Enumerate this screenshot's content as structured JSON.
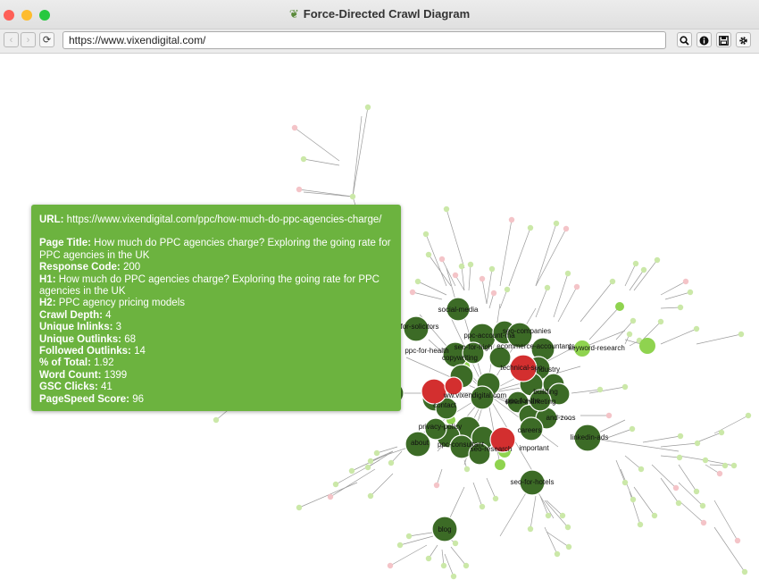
{
  "window": {
    "title": "Force-Directed Crawl Diagram",
    "traffic_lights": [
      "#fe5f57",
      "#febc2e",
      "#28c840"
    ]
  },
  "toolbar": {
    "url": "https://www.vixendigital.com/",
    "buttons": [
      "back-icon",
      "forward-icon",
      "refresh-icon",
      "search-icon",
      "info-icon",
      "save-icon",
      "settings-icon"
    ]
  },
  "colors": {
    "node_dark": "#3c6b26",
    "node_red": "#d32f2f",
    "node_light_green": "#cbe8a8",
    "node_light_pink": "#f4c4c8",
    "tooltip_bg": "#6cb33f"
  },
  "tooltip": {
    "url_label": "URL:",
    "url": "https://www.vixendigital.com/ppc/how-much-do-ppc-agencies-charge/",
    "page_title_label": "Page Title:",
    "page_title": "How much do PPC agencies charge? Exploring the going rate for PPC agencies in the UK",
    "response_code_label": "Response Code:",
    "response_code": "200",
    "h1_label": "H1:",
    "h1": "How much do PPC agencies charge? Exploring the going rate for PPC agencies in the UK",
    "h2_label": "H2:",
    "h2": "PPC agency pricing models",
    "crawl_depth_label": "Crawl Depth:",
    "crawl_depth": "4",
    "unique_inlinks_label": "Unique Inlinks:",
    "unique_inlinks": "3",
    "unique_outlinks_label": "Unique Outlinks:",
    "unique_outlinks": "68",
    "followed_outlinks_label": "Followed Outlinks:",
    "followed_outlinks": "14",
    "pct_total_label": "% of Total:",
    "pct_total": "1.92",
    "word_count_label": "Word Count:",
    "word_count": "1399",
    "gsc_clicks_label": "GSC Clicks:",
    "gsc_clicks": "41",
    "pagespeed_label": "PageSpeed Score:",
    "pagespeed": "96"
  },
  "graph": {
    "labels": [
      "social-media",
      "for-solicitors",
      "ppc-account-ma",
      "seo-companies",
      "ecommerce-accountants",
      "keyword-research",
      "ppc-for-health",
      "seo-for-high",
      "technical-seo",
      "industry",
      "copywriting",
      "ww.vixendigital.com",
      "contact",
      "building",
      "ppc-for-the",
      "careers",
      "privacy-policy",
      "about",
      "ppc-consultant",
      "seo-research",
      "important",
      "linkedin-ads",
      "seo-for-hotels",
      "blog",
      "email-marketing",
      "and-zoos"
    ]
  }
}
